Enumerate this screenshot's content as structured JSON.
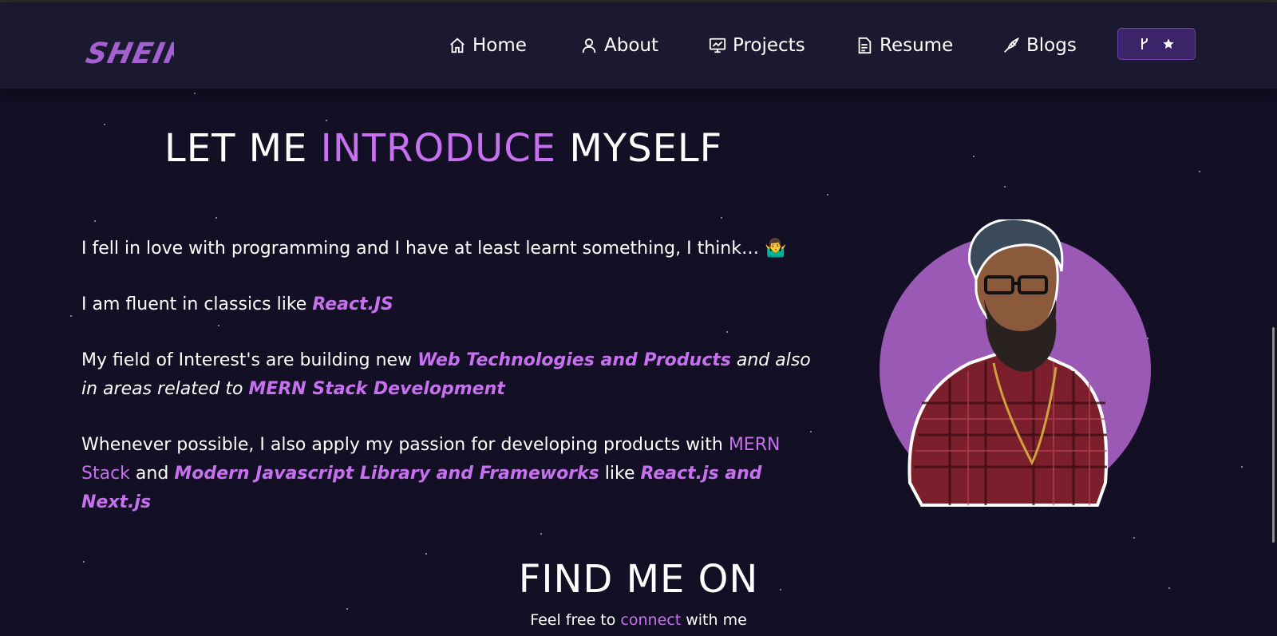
{
  "brand": {
    "logo_text": "SHEIK"
  },
  "nav": {
    "items": [
      {
        "label": "Home",
        "icon": "home-icon"
      },
      {
        "label": "About",
        "icon": "user-icon"
      },
      {
        "label": "Projects",
        "icon": "presentation-icon"
      },
      {
        "label": "Resume",
        "icon": "document-icon"
      },
      {
        "label": "Blogs",
        "icon": "pen-icon"
      }
    ],
    "github_button": {
      "icons": [
        "git-fork-icon",
        "star-icon"
      ]
    }
  },
  "intro": {
    "heading_part1": "LET ME",
    "heading_highlight": "INTRODUCE",
    "heading_part2": "MYSELF",
    "p1": "I fell in love with programming and I have at least learnt something, I think… ",
    "p1_emoji": "🤷‍♂️",
    "p2_text": "I am fluent in classics like",
    "p2_highlight": "React.JS",
    "p3_text": "My field of Interest's are building new ",
    "p3_highlight1": "Web Technologies and Products",
    "p3_mid": " and also in areas related to ",
    "p3_highlight2": "MERN Stack Development",
    "p4_text": "Whenever possible, I also apply my passion for developing products with ",
    "p4_highlight1": "MERN Stack",
    "p4_and": " and ",
    "p4_highlight2": "Modern Javascript Library and Frameworks",
    "p4_like": " like ",
    "p4_highlight3": "React.js and Next.js"
  },
  "find": {
    "title": "FIND ME ON",
    "subtitle_pre": "Feel free to",
    "subtitle_link": "connect",
    "subtitle_post": "with me"
  },
  "colors": {
    "accent": "#c770f0",
    "background": "#130f24",
    "navbar": "#1b1930",
    "avatar_circle": "#9b59b6"
  }
}
